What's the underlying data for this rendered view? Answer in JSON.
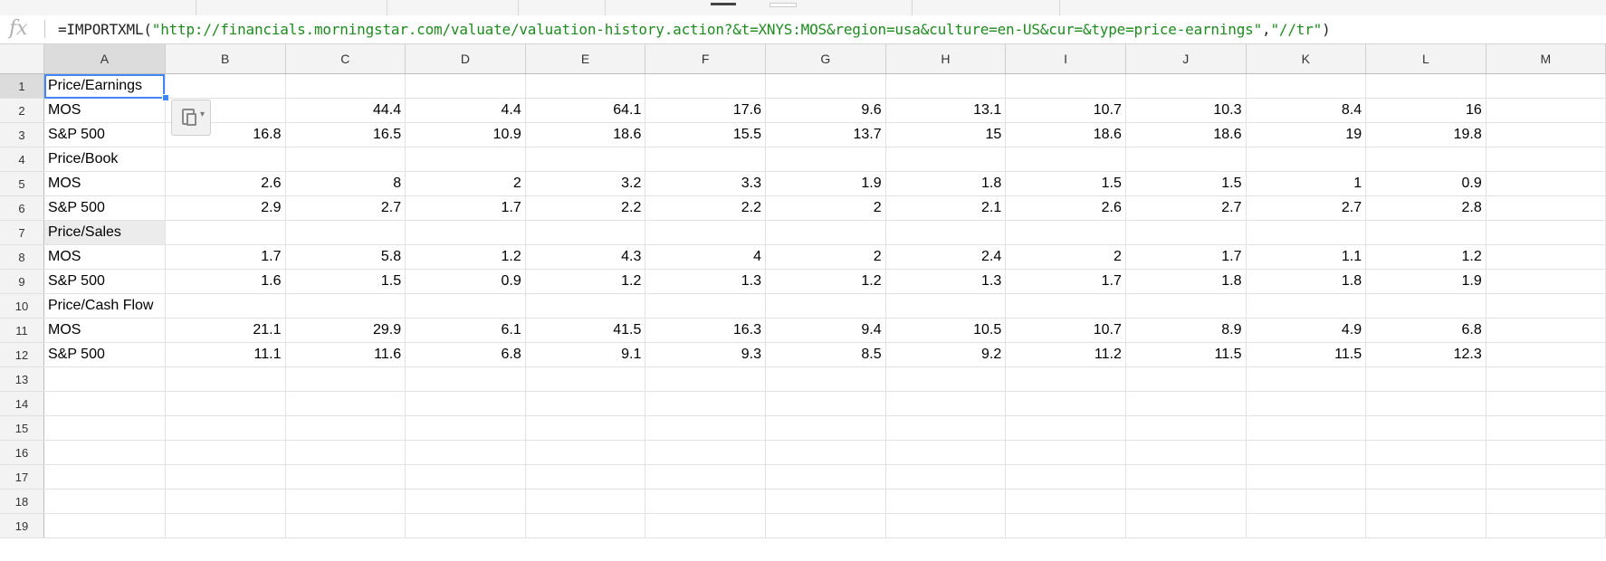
{
  "formula_bar": {
    "fx_label": "fx",
    "prefix": "=IMPORTXML(",
    "url_string": "\"http://financials.morningstar.com/valuate/valuation-history.action?&t=XNYS:MOS&region=usa&culture=en-US&cur=&type=price-earnings\"",
    "comma": ",",
    "xpath_string": "\"//tr\"",
    "suffix": ")"
  },
  "columns": [
    "A",
    "B",
    "C",
    "D",
    "E",
    "F",
    "G",
    "H",
    "I",
    "J",
    "K",
    "L",
    "M"
  ],
  "row_numbers": [
    "1",
    "2",
    "3",
    "4",
    "5",
    "6",
    "7",
    "8",
    "9",
    "10",
    "11",
    "12",
    "13",
    "14",
    "15",
    "16",
    "17",
    "18",
    "19"
  ],
  "rows": [
    [
      "Price/Earnings",
      "",
      "",
      "",
      "",
      "",
      "",
      "",
      "",
      "",
      "",
      "",
      ""
    ],
    [
      "MOS",
      "",
      "44.4",
      "4.4",
      "64.1",
      "17.6",
      "9.6",
      "13.1",
      "10.7",
      "10.3",
      "8.4",
      "16",
      ""
    ],
    [
      "S&P 500",
      "16.8",
      "16.5",
      "10.9",
      "18.6",
      "15.5",
      "13.7",
      "15",
      "18.6",
      "18.6",
      "19",
      "19.8",
      ""
    ],
    [
      "Price/Book",
      "",
      "",
      "",
      "",
      "",
      "",
      "",
      "",
      "",
      "",
      "",
      ""
    ],
    [
      "MOS",
      "2.6",
      "8",
      "2",
      "3.2",
      "3.3",
      "1.9",
      "1.8",
      "1.5",
      "1.5",
      "1",
      "0.9",
      ""
    ],
    [
      "S&P 500",
      "2.9",
      "2.7",
      "1.7",
      "2.2",
      "2.2",
      "2",
      "2.1",
      "2.6",
      "2.7",
      "2.7",
      "2.8",
      ""
    ],
    [
      "Price/Sales",
      "",
      "",
      "",
      "",
      "",
      "",
      "",
      "",
      "",
      "",
      "",
      ""
    ],
    [
      "MOS",
      "1.7",
      "5.8",
      "1.2",
      "4.3",
      "4",
      "2",
      "2.4",
      "2",
      "1.7",
      "1.1",
      "1.2",
      ""
    ],
    [
      "S&P 500",
      "1.6",
      "1.5",
      "0.9",
      "1.2",
      "1.3",
      "1.2",
      "1.3",
      "1.7",
      "1.8",
      "1.8",
      "1.9",
      ""
    ],
    [
      "Price/Cash Flow",
      "",
      "",
      "",
      "",
      "",
      "",
      "",
      "",
      "",
      "",
      "",
      ""
    ],
    [
      "MOS",
      "21.1",
      "29.9",
      "6.1",
      "41.5",
      "16.3",
      "9.4",
      "10.5",
      "10.7",
      "8.9",
      "4.9",
      "6.8",
      ""
    ],
    [
      "S&P 500",
      "11.1",
      "11.6",
      "6.8",
      "9.1",
      "9.3",
      "8.5",
      "9.2",
      "11.2",
      "11.5",
      "11.5",
      "12.3",
      ""
    ],
    [
      "",
      "",
      "",
      "",
      "",
      "",
      "",
      "",
      "",
      "",
      "",
      "",
      ""
    ],
    [
      "",
      "",
      "",
      "",
      "",
      "",
      "",
      "",
      "",
      "",
      "",
      "",
      ""
    ],
    [
      "",
      "",
      "",
      "",
      "",
      "",
      "",
      "",
      "",
      "",
      "",
      "",
      ""
    ],
    [
      "",
      "",
      "",
      "",
      "",
      "",
      "",
      "",
      "",
      "",
      "",
      "",
      ""
    ],
    [
      "",
      "",
      "",
      "",
      "",
      "",
      "",
      "",
      "",
      "",
      "",
      "",
      ""
    ],
    [
      "",
      "",
      "",
      "",
      "",
      "",
      "",
      "",
      "",
      "",
      "",
      "",
      ""
    ],
    [
      "",
      "",
      "",
      "",
      "",
      "",
      "",
      "",
      "",
      "",
      "",
      "",
      ""
    ]
  ],
  "selected_cell": "A1",
  "shaded_cell": "A7",
  "colors": {
    "selection": "#4285f4",
    "formula_string": "#1f8a1f",
    "header_bg": "#f3f3f3"
  }
}
